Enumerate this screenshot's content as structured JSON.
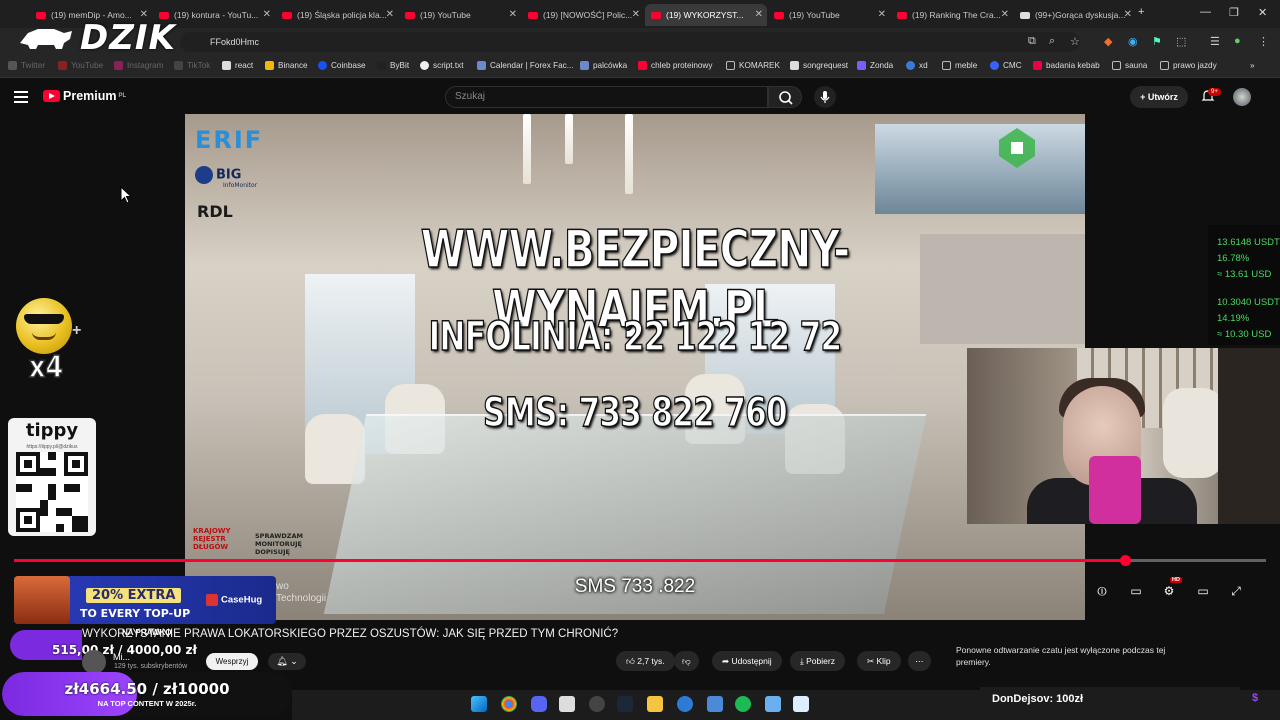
{
  "browser": {
    "tabs": [
      {
        "label": "(19) memDip - Amo..."
      },
      {
        "label": "(19) kontura - YouTu..."
      },
      {
        "label": "(19) Śląska policja kla..."
      },
      {
        "label": "(19) YouTube"
      },
      {
        "label": "(19) [NOWOŚĆ] Polic..."
      },
      {
        "label": "(19) WYKORZYST..."
      },
      {
        "label": "(19) YouTube"
      },
      {
        "label": "(19) Ranking The Cra..."
      },
      {
        "label": "(99+)Gorąca dyskusja..."
      }
    ],
    "url": "FFokd0Hmc",
    "bookmarks": [
      {
        "label": "Twitter"
      },
      {
        "label": "YouTube"
      },
      {
        "label": "Instagram"
      },
      {
        "label": "TikTok"
      },
      {
        "label": "react"
      },
      {
        "label": "Binance"
      },
      {
        "label": "Coinbase"
      },
      {
        "label": "ByBit"
      },
      {
        "label": "script.txt"
      },
      {
        "label": "Calendar | Forex Fac..."
      },
      {
        "label": "palcówka"
      },
      {
        "label": "chleb proteinowy"
      },
      {
        "label": "KOMAREK"
      },
      {
        "label": "songrequest"
      },
      {
        "label": "Zonda"
      },
      {
        "label": "xd"
      },
      {
        "label": "meble"
      },
      {
        "label": "CMC"
      },
      {
        "label": "badania kebab"
      },
      {
        "label": "sauna"
      },
      {
        "label": "prawo jazdy"
      }
    ]
  },
  "overlay": {
    "logo": "DZIK",
    "multiplier": "x4",
    "tippy_name": "tippy",
    "tippy_url": "https://tippy.pl/@dzikus",
    "promo_pct": "20% EXTRA",
    "promo_sub": "TO EVERY TOP-UP",
    "promo_brand": "CaseHug",
    "donation_amount": "515,00 zł",
    "donation_amount2": "4000,00 zł",
    "napr_label": "NA PRAWKO",
    "goal_text": "zł4664.50 / zł10000",
    "goal_sub": "NA TOP CONTENT W 2025r.",
    "goal_progress": 0.466,
    "last_donation": "DonDejsov:  100zł",
    "ticker": [
      {
        "value": "13.6148 USDT"
      },
      {
        "value": "16.78%"
      },
      {
        "value": "≈ 13.61 USD"
      },
      {
        "value": "10.3040 USDT"
      },
      {
        "value": "14.19%"
      },
      {
        "value": "≈ 10.30 USD"
      }
    ]
  },
  "youtube": {
    "brand": "Premium",
    "brand_region": "PL",
    "search_placeholder": "Szukaj",
    "create_label": "Utwórz",
    "notif_count": "9+",
    "video": {
      "banner_url": "WWW.BEZPIECZNY-WYNAJEM.PL",
      "infoline": "INFOLINIA: 22 122 12 72",
      "sms": "SMS: 733 822 760",
      "subtitle": "SMS 733 .822",
      "logos": [
        "ERIF",
        "BIG",
        "InfoMonitor",
        "RDL",
        "KRAJOWY REJESTR DŁUGÓW",
        "SPRAWDZAM MONITORUJĘ DOPISUJĘ"
      ],
      "progress": 0.887,
      "behind_text_1": "wo",
      "behind_text_2": "Technologii"
    },
    "title": "WYKORZYSTANIE PRAWA LOKATORSKIEGO PRZEZ OSZUSTÓW: JAK SIĘ PRZED TYM CHRONIĆ?",
    "channel": "Mi...",
    "subscribers": "129 tys. subskrybentów",
    "support_label": "Wesprzyj",
    "likes": "2,7 tys.",
    "share_label": "Udostępnij",
    "download_label": "Pobierz",
    "clip_label": "Klip",
    "chat_note": "Ponowne odtwarzanie czatu jest wyłączone podczas tej premiery."
  },
  "colors": {
    "yt_red": "#ff0033",
    "goal_purple": "#7b2ae0",
    "ticker_green": "#4cd964"
  }
}
